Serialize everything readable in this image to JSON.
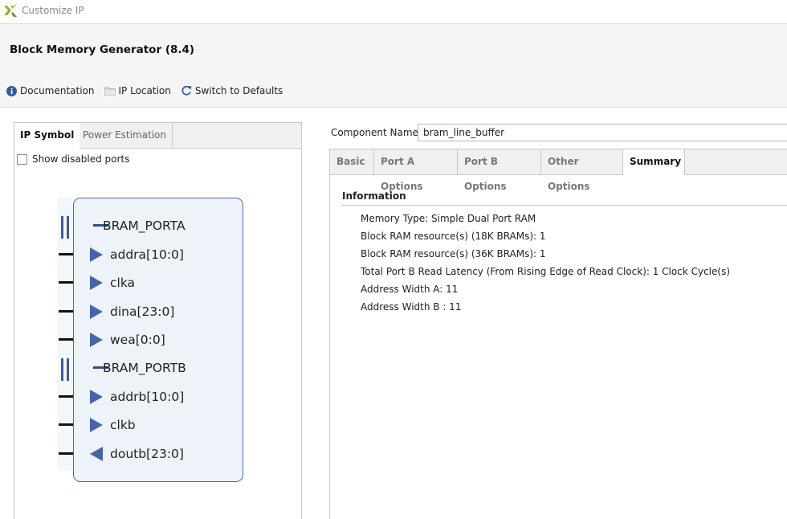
{
  "window": {
    "title": "Customize IP",
    "logo_icon": "xilinx-logo-icon"
  },
  "header": {
    "ip_name": "Block Memory Generator (8.4)",
    "toolbar": [
      {
        "label": "Documentation",
        "icon": "info-icon"
      },
      {
        "label": "IP Location",
        "icon": "folder-icon"
      },
      {
        "label": "Switch to Defaults",
        "icon": "refresh-icon"
      }
    ]
  },
  "left_panel": {
    "tabs": [
      {
        "label": "IP Symbol",
        "active": true
      },
      {
        "label": "Power Estimation",
        "active": false
      }
    ],
    "show_disabled_ports": {
      "label": "Show disabled ports",
      "checked": false
    },
    "symbol": {
      "pins": [
        {
          "label": "BRAM_PORTA",
          "kind": "bus"
        },
        {
          "label": "addra[10:0]",
          "kind": "input"
        },
        {
          "label": "clka",
          "kind": "input"
        },
        {
          "label": "dina[23:0]",
          "kind": "input"
        },
        {
          "label": "wea[0:0]",
          "kind": "input"
        },
        {
          "label": "BRAM_PORTB",
          "kind": "bus"
        },
        {
          "label": "addrb[10:0]",
          "kind": "input"
        },
        {
          "label": "clkb",
          "kind": "input"
        },
        {
          "label": "doutb[23:0]",
          "kind": "output"
        }
      ]
    }
  },
  "right_panel": {
    "component_name": {
      "label": "Component Name",
      "value": "bram_line_buffer"
    },
    "tabs": [
      {
        "label": "Basic",
        "active": false
      },
      {
        "label": "Port A Options",
        "active": false
      },
      {
        "label": "Port B Options",
        "active": false
      },
      {
        "label": "Other Options",
        "active": false
      },
      {
        "label": "Summary",
        "active": true
      }
    ],
    "summary": {
      "section_title": "Information",
      "lines": [
        "Memory Type: Simple Dual Port RAM",
        "Block RAM resource(s) (18K BRAMs): 1",
        "Block RAM resource(s) (36K BRAMs): 1",
        "Total Port B Read Latency (From Rising Edge of Read Clock): 1 Clock Cycle(s)",
        "Address Width A: 11",
        "Address Width B : 11"
      ]
    }
  },
  "colors": {
    "symbol_fill": "#eef3f9",
    "symbol_border": "#4a6aa8",
    "pin_arrow": "#4466a8",
    "tab_bar": "#f0f0f0"
  }
}
